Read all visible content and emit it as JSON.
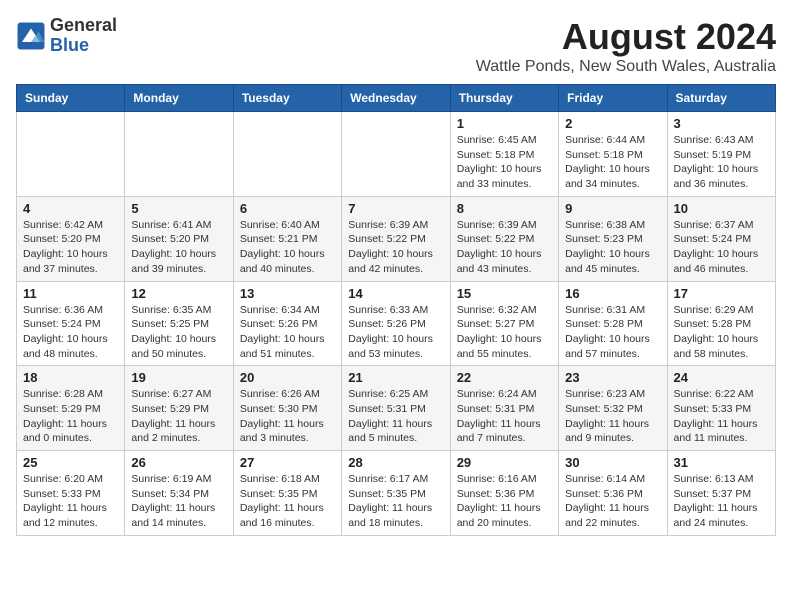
{
  "header": {
    "logo_general": "General",
    "logo_blue": "Blue",
    "month_year": "August 2024",
    "location": "Wattle Ponds, New South Wales, Australia"
  },
  "calendar": {
    "days_of_week": [
      "Sunday",
      "Monday",
      "Tuesday",
      "Wednesday",
      "Thursday",
      "Friday",
      "Saturday"
    ],
    "weeks": [
      [
        {
          "day": "",
          "info": ""
        },
        {
          "day": "",
          "info": ""
        },
        {
          "day": "",
          "info": ""
        },
        {
          "day": "",
          "info": ""
        },
        {
          "day": "1",
          "info": "Sunrise: 6:45 AM\nSunset: 5:18 PM\nDaylight: 10 hours\nand 33 minutes."
        },
        {
          "day": "2",
          "info": "Sunrise: 6:44 AM\nSunset: 5:18 PM\nDaylight: 10 hours\nand 34 minutes."
        },
        {
          "day": "3",
          "info": "Sunrise: 6:43 AM\nSunset: 5:19 PM\nDaylight: 10 hours\nand 36 minutes."
        }
      ],
      [
        {
          "day": "4",
          "info": "Sunrise: 6:42 AM\nSunset: 5:20 PM\nDaylight: 10 hours\nand 37 minutes."
        },
        {
          "day": "5",
          "info": "Sunrise: 6:41 AM\nSunset: 5:20 PM\nDaylight: 10 hours\nand 39 minutes."
        },
        {
          "day": "6",
          "info": "Sunrise: 6:40 AM\nSunset: 5:21 PM\nDaylight: 10 hours\nand 40 minutes."
        },
        {
          "day": "7",
          "info": "Sunrise: 6:39 AM\nSunset: 5:22 PM\nDaylight: 10 hours\nand 42 minutes."
        },
        {
          "day": "8",
          "info": "Sunrise: 6:39 AM\nSunset: 5:22 PM\nDaylight: 10 hours\nand 43 minutes."
        },
        {
          "day": "9",
          "info": "Sunrise: 6:38 AM\nSunset: 5:23 PM\nDaylight: 10 hours\nand 45 minutes."
        },
        {
          "day": "10",
          "info": "Sunrise: 6:37 AM\nSunset: 5:24 PM\nDaylight: 10 hours\nand 46 minutes."
        }
      ],
      [
        {
          "day": "11",
          "info": "Sunrise: 6:36 AM\nSunset: 5:24 PM\nDaylight: 10 hours\nand 48 minutes."
        },
        {
          "day": "12",
          "info": "Sunrise: 6:35 AM\nSunset: 5:25 PM\nDaylight: 10 hours\nand 50 minutes."
        },
        {
          "day": "13",
          "info": "Sunrise: 6:34 AM\nSunset: 5:26 PM\nDaylight: 10 hours\nand 51 minutes."
        },
        {
          "day": "14",
          "info": "Sunrise: 6:33 AM\nSunset: 5:26 PM\nDaylight: 10 hours\nand 53 minutes."
        },
        {
          "day": "15",
          "info": "Sunrise: 6:32 AM\nSunset: 5:27 PM\nDaylight: 10 hours\nand 55 minutes."
        },
        {
          "day": "16",
          "info": "Sunrise: 6:31 AM\nSunset: 5:28 PM\nDaylight: 10 hours\nand 57 minutes."
        },
        {
          "day": "17",
          "info": "Sunrise: 6:29 AM\nSunset: 5:28 PM\nDaylight: 10 hours\nand 58 minutes."
        }
      ],
      [
        {
          "day": "18",
          "info": "Sunrise: 6:28 AM\nSunset: 5:29 PM\nDaylight: 11 hours\nand 0 minutes."
        },
        {
          "day": "19",
          "info": "Sunrise: 6:27 AM\nSunset: 5:29 PM\nDaylight: 11 hours\nand 2 minutes."
        },
        {
          "day": "20",
          "info": "Sunrise: 6:26 AM\nSunset: 5:30 PM\nDaylight: 11 hours\nand 3 minutes."
        },
        {
          "day": "21",
          "info": "Sunrise: 6:25 AM\nSunset: 5:31 PM\nDaylight: 11 hours\nand 5 minutes."
        },
        {
          "day": "22",
          "info": "Sunrise: 6:24 AM\nSunset: 5:31 PM\nDaylight: 11 hours\nand 7 minutes."
        },
        {
          "day": "23",
          "info": "Sunrise: 6:23 AM\nSunset: 5:32 PM\nDaylight: 11 hours\nand 9 minutes."
        },
        {
          "day": "24",
          "info": "Sunrise: 6:22 AM\nSunset: 5:33 PM\nDaylight: 11 hours\nand 11 minutes."
        }
      ],
      [
        {
          "day": "25",
          "info": "Sunrise: 6:20 AM\nSunset: 5:33 PM\nDaylight: 11 hours\nand 12 minutes."
        },
        {
          "day": "26",
          "info": "Sunrise: 6:19 AM\nSunset: 5:34 PM\nDaylight: 11 hours\nand 14 minutes."
        },
        {
          "day": "27",
          "info": "Sunrise: 6:18 AM\nSunset: 5:35 PM\nDaylight: 11 hours\nand 16 minutes."
        },
        {
          "day": "28",
          "info": "Sunrise: 6:17 AM\nSunset: 5:35 PM\nDaylight: 11 hours\nand 18 minutes."
        },
        {
          "day": "29",
          "info": "Sunrise: 6:16 AM\nSunset: 5:36 PM\nDaylight: 11 hours\nand 20 minutes."
        },
        {
          "day": "30",
          "info": "Sunrise: 6:14 AM\nSunset: 5:36 PM\nDaylight: 11 hours\nand 22 minutes."
        },
        {
          "day": "31",
          "info": "Sunrise: 6:13 AM\nSunset: 5:37 PM\nDaylight: 11 hours\nand 24 minutes."
        }
      ]
    ]
  }
}
